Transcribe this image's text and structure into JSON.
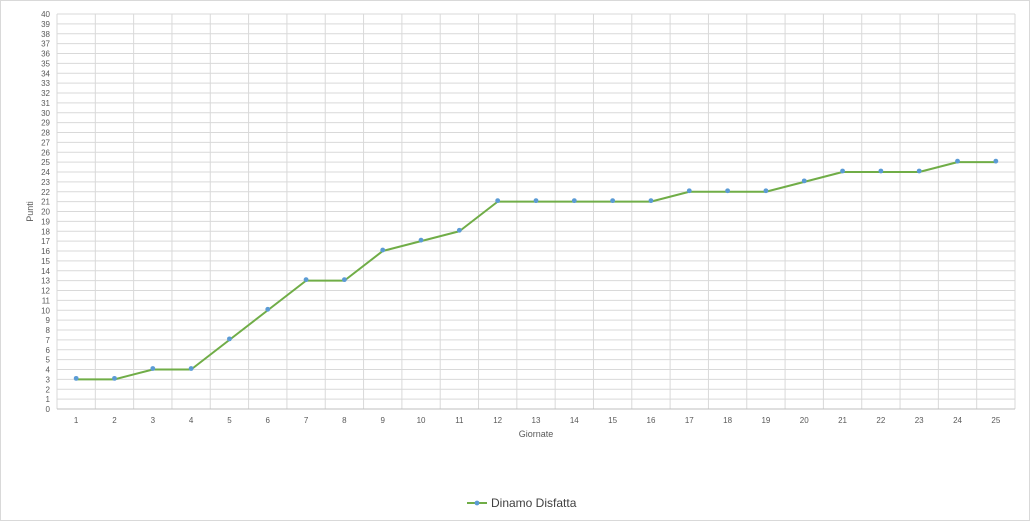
{
  "chart_data": {
    "type": "line",
    "title": "",
    "xlabel": "Giornate",
    "ylabel": "Punti",
    "categories": [
      "1",
      "2",
      "3",
      "4",
      "5",
      "6",
      "7",
      "8",
      "9",
      "10",
      "11",
      "12",
      "13",
      "14",
      "15",
      "16",
      "17",
      "18",
      "19",
      "20",
      "21",
      "22",
      "23",
      "24",
      "25"
    ],
    "ylim": [
      0,
      40
    ],
    "ytick_step": 1,
    "grid": true,
    "legend_position": "bottom",
    "series": [
      {
        "name": "Dinamo Disfatta",
        "values": [
          3,
          3,
          4,
          4,
          7,
          10,
          13,
          13,
          16,
          17,
          18,
          21,
          21,
          21,
          21,
          21,
          22,
          22,
          22,
          23,
          24,
          24,
          24,
          25,
          25
        ],
        "line_color": "#70ad47",
        "marker_color": "#5b9bd5"
      }
    ]
  }
}
